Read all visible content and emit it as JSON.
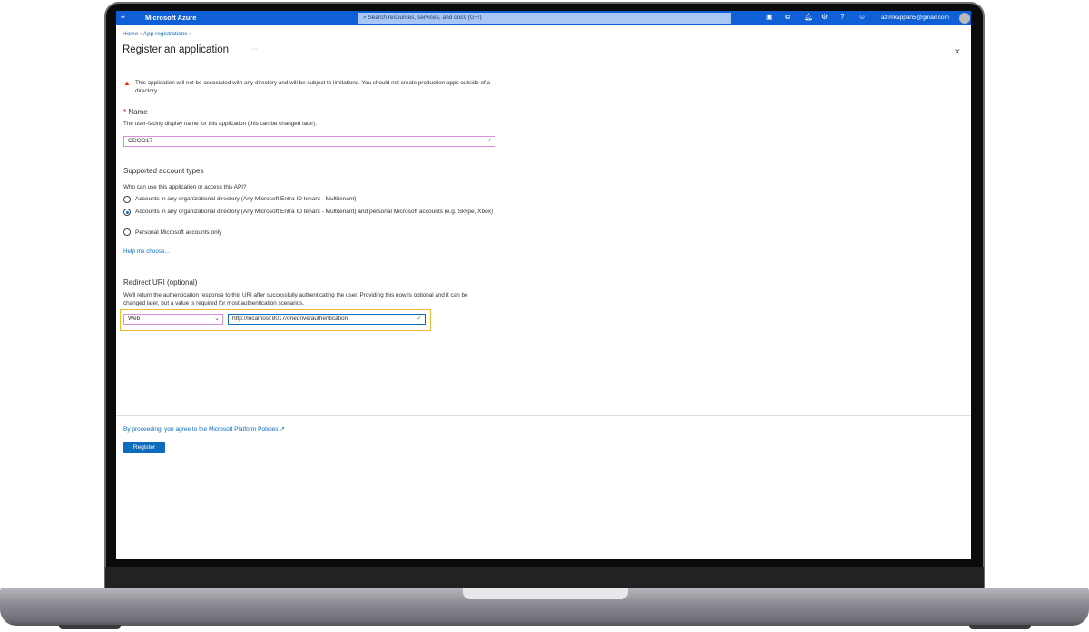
{
  "topbar": {
    "menu_icon": "hamburger-icon",
    "brand": "Microsoft Azure",
    "search_placeholder": "Search resources, services, and docs (G+/)",
    "icons": [
      "cloud-shell-icon",
      "directory-filter-icon",
      "notifications-icon",
      "settings-icon",
      "help-icon",
      "feedback-icon"
    ],
    "account": "azimkappan5@gmail.com"
  },
  "breadcrumb": [
    "Home",
    "App registrations"
  ],
  "page": {
    "title": "Register an application",
    "more": "···",
    "close": "✕"
  },
  "warning": "This application will not be associated with any directory and will be subject to limitations. You should not create production apps outside of a directory.",
  "name_section": {
    "required": "*",
    "label": "Name",
    "description": "The user-facing display name for this application (this can be changed later).",
    "value": "ODOO17"
  },
  "accounts": {
    "heading": "Supported account types",
    "question": "Who can use this application or access this API?",
    "options": [
      {
        "label": "Accounts in any organizational directory (Any Microsoft Entra ID tenant - Multitenant)",
        "selected": false
      },
      {
        "label": "Accounts in any organizational directory (Any Microsoft Entra ID tenant - Multitenant) and personal Microsoft accounts (e.g. Skype, Xbox)",
        "selected": true
      },
      {
        "label": "Personal Microsoft accounts only",
        "selected": false
      }
    ],
    "help_link": "Help me choose..."
  },
  "redirect": {
    "heading": "Redirect URI (optional)",
    "description": "We'll return the authentication response to this URI after successfully authenticating the user. Providing this now is optional and it can be changed later, but a value is required for most authentication scenarios.",
    "platform": "Web",
    "uri": "http://localhost:8017/onedrive/authentication"
  },
  "footer": {
    "policy_link": "By proceeding, you agree to the Microsoft Platform Policies",
    "register": "Register"
  },
  "colors": {
    "brand": "#0f5fd6",
    "highlight_name": "#d58fdd",
    "highlight_redirect": "#f5b82e"
  }
}
